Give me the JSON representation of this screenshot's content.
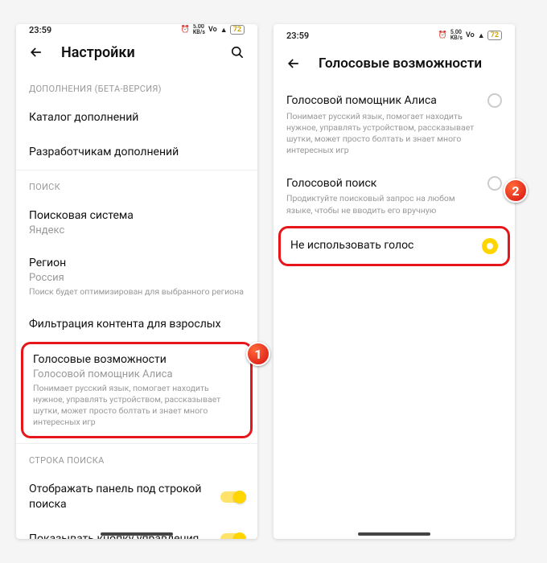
{
  "statusbar": {
    "time": "23:59",
    "alarm": "⏰",
    "net_top": "5.00",
    "net_bot": "KB/s",
    "vo": "Vo",
    "wifi": "⁴ᴳ",
    "sig": "▲",
    "battery": "72"
  },
  "left": {
    "title": "Настройки",
    "sec_ext": "ДОПОЛНЕНИЯ (БЕТА-ВЕРСИЯ)",
    "ext_catalog": "Каталог дополнений",
    "ext_dev": "Разработчикам дополнений",
    "sec_search": "ПОИСК",
    "search_engine_t": "Поисковая система",
    "search_engine_v": "Яндекс",
    "region_t": "Регион",
    "region_v": "Россия",
    "region_note": "Поиск будет оптимизирован для выбранного региона",
    "adult_filter": "Фильтрация контента для взрослых",
    "voice_t": "Голосовые возможности",
    "voice_sub": "Голосовой помощник Алиса",
    "voice_note": "Понимает русский язык, помогает находить нужное, управлять устройством, рассказывает шутки, может просто болтать и знает много интересных игр",
    "sec_bar": "СТРОКА ПОИСКА",
    "show_panel": "Отображать панель под строкой поиска",
    "show_ctrl": "Показывать кнопку управления"
  },
  "right": {
    "title": "Голосовые возможности",
    "alice_t": "Голосовой помощник Алиса",
    "alice_note": "Понимает русский язык, помогает находить нужное, управлять устройством, рассказывает шутки, может просто болтать и знает много интересных игр",
    "vsearch_t": "Голосовой поиск",
    "vsearch_note": "Продиктуйте поисковый запрос на любом языке, чтобы не вводить его вручную",
    "novoice_t": "Не использовать голос"
  },
  "badges": {
    "one": "1",
    "two": "2"
  }
}
